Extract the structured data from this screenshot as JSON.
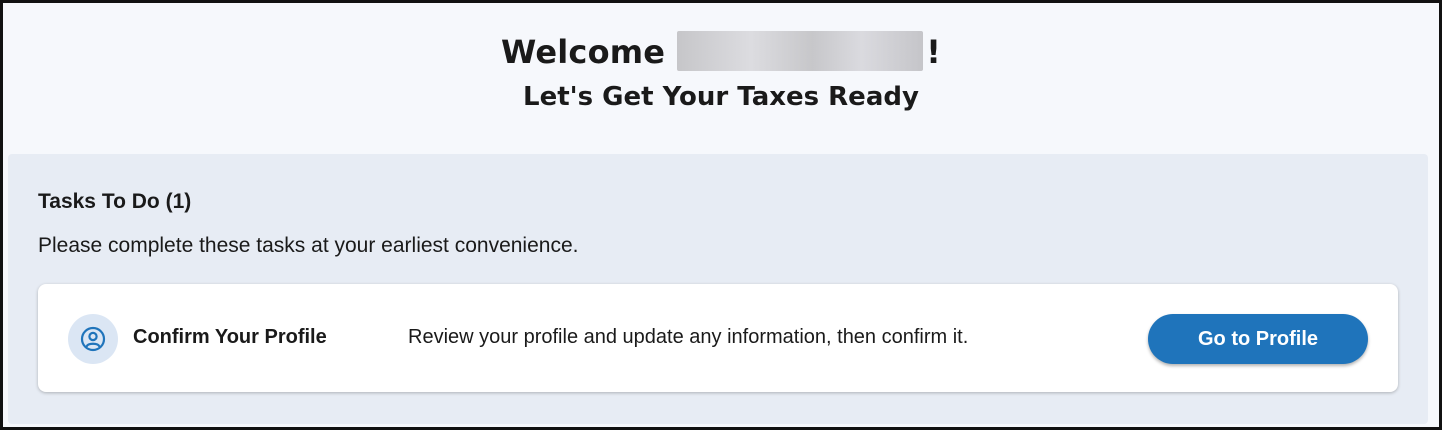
{
  "header": {
    "welcome_prefix": "Welcome",
    "welcome_suffix": "!",
    "subtitle": "Let's Get Your Taxes Ready"
  },
  "tasks": {
    "title": "Tasks To Do (1)",
    "description": "Please complete these tasks at your earliest convenience.",
    "items": [
      {
        "icon": "user-circle-icon",
        "name": "Confirm Your Profile",
        "detail": "Review your profile and update any information, then confirm it.",
        "action_label": "Go to Profile"
      }
    ]
  },
  "colors": {
    "primary": "#1f74bb",
    "panel_bg": "#e7ecf4",
    "page_bg": "#f6f8fc",
    "icon_bg": "#dbe6f4"
  }
}
